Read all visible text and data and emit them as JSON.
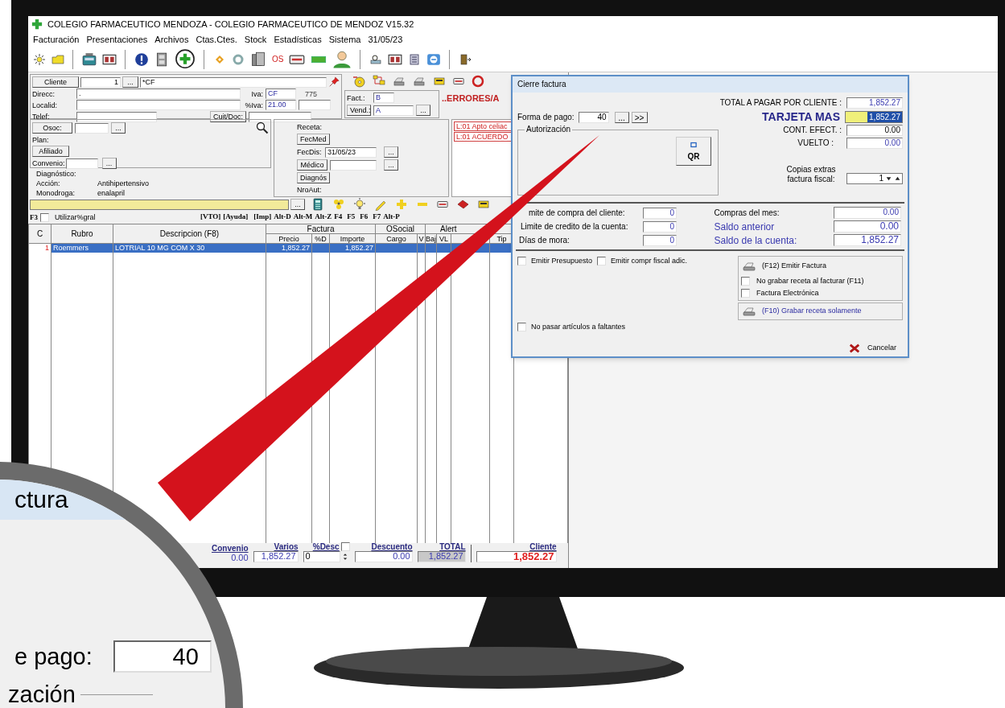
{
  "window": {
    "title": "COLEGIO FARMACEUTICO MENDOZA - COLEGIO FARMACEUTICO DE MENDOZ V15.32"
  },
  "menu": [
    {
      "label": "Facturación"
    },
    {
      "label": "Presentaciones"
    },
    {
      "label": "Archivos"
    },
    {
      "label": "Ctas.Ctes."
    },
    {
      "label": "Stock"
    },
    {
      "label": "Estadísticas"
    },
    {
      "label": "Sistema"
    },
    {
      "label": "31/05/23"
    }
  ],
  "toolbar": {
    "os_label": "OS"
  },
  "client": {
    "cliente_button": "Cliente",
    "code": "1",
    "more": "...",
    "name": "*CF",
    "direcc_label": "Direcc:",
    "direcc": ".",
    "iva_label": "Iva:",
    "iva": "CF",
    "iva_code": "775",
    "localid_label": "Localid:",
    "pct_iva_label": "%Iva:",
    "pct_iva": "21.00",
    "telef_label": "Telef:",
    "cuit_button": "Cuit/Doc:"
  },
  "invoice": {
    "fact_label": "Fact.:",
    "fact": "B",
    "vend_button": "Vend.:",
    "vend": "A",
    "more": "..."
  },
  "errors": {
    "title": "..ERRORES/A",
    "items": [
      "L:01 Apto celiac",
      "L:01 ACUERDO"
    ]
  },
  "obra_social": {
    "osoc_button": "Osoc:",
    "more": "...",
    "plan_label": "Plan:",
    "afiliado_button": "Afiliado",
    "convenio_label": "Convenio:",
    "convenio_more": "..."
  },
  "diagnosis": [
    {
      "label": "Diagnóstico:"
    },
    {
      "label": "Acción:",
      "value": "Antihipertensivo"
    },
    {
      "label": "Monodroga:",
      "value": "enalapril"
    }
  ],
  "prescription": {
    "receta_label": "Receta:",
    "fecmed_button": "FecMed",
    "fecdis_label": "FecDis:",
    "fecdis": "31/05/23",
    "fecdis_more": "...",
    "medico_button": "Médico",
    "medico_more": "...",
    "diagnos_button": "Diagnós",
    "nroaut_label": "NroAut:"
  },
  "search_bar": {
    "more": "..."
  },
  "shortcuts": {
    "f3_label": "F3",
    "utilizar_checked": false,
    "utilizar_label": "Utilizar%gral",
    "keys": [
      "[VTO]",
      "[Ayuda]",
      "[Imp]",
      "Alt-D",
      "Alt-M",
      "Alt-Z",
      "F4",
      "F5",
      "F6",
      "F7",
      "Alt-P"
    ]
  },
  "table": {
    "top_headers": [
      "C",
      "Rubro",
      "Descripcion (F8)",
      "Factura",
      "OSocial",
      "Alert"
    ],
    "sub_headers": [
      "Precio",
      "%D",
      "Importe",
      "Cargo",
      "V",
      "Baj",
      "VL",
      "Tip"
    ],
    "rows": [
      {
        "selected": true,
        "cells": [
          "1",
          "Roemmers",
          "LOTRIAL 10 MG COM X 30",
          "1,852.27",
          "",
          "1,852.27"
        ]
      }
    ]
  },
  "footer": {
    "convenio_label": "Convenio",
    "convenio": "0.00",
    "varios_label": "Varios",
    "varios": "1,852.27",
    "pct_desc_label": "%Desc",
    "pct_desc": "0",
    "descuento_checked": false,
    "descuento_label": "Descuento",
    "descuento": "0.00",
    "total_label": "TOTAL",
    "total": "1,852.27",
    "cliente_label": "Cliente",
    "cliente": "1,852.27"
  },
  "dialog": {
    "title": "Cierre factura",
    "total_label": "TOTAL A PAGAR POR CLIENTE :",
    "total": "1,852.27",
    "forma_pago_label": "Forma de pago:",
    "forma_pago": "40",
    "more": "...",
    "next": ">>",
    "autorizacion_label": "Autorización",
    "qr_button": "QR",
    "payment_label": "TARJETA MAS",
    "payment": "1,852.27",
    "payment_selected": true,
    "cont_label": "CONT. EFECT. :",
    "cont": "0.00",
    "vuelto_label": "VUELTO :",
    "vuelto": "0.00",
    "copias_label": "Copias extras factura fiscal:",
    "copias": "1",
    "limits": [
      {
        "label": "mite de compra del cliente:",
        "value": "0"
      },
      {
        "label": "Limite de credito de la cuenta:",
        "value": "0"
      },
      {
        "label": "Días de mora:",
        "value": "0"
      }
    ],
    "account": [
      {
        "label": "Compras del mes:",
        "value": "0.00",
        "emphasis": false
      },
      {
        "label": "Saldo anterior",
        "value": "0.00",
        "emphasis": true
      },
      {
        "label": "Saldo de la cuenta:",
        "value": "1,852.27",
        "emphasis": true
      }
    ],
    "options": [
      {
        "label": "Emitir Presupuesto",
        "checked": false
      },
      {
        "label": "Emitir compr fiscal adic.",
        "checked": false
      }
    ],
    "emit_button": "(F12) Emitir Factura",
    "emit_options": [
      {
        "label": "No grabar receta al facturar (F11)",
        "checked": false
      },
      {
        "label": "Factura Electrónica",
        "checked": false
      }
    ],
    "record_button": "(F10) Grabar receta solamente",
    "faltantes": {
      "label": "No pasar artículos a faltantes",
      "checked": false
    },
    "cancel_button": "Cancelar"
  },
  "magnifier": {
    "title_fragment": "ctura",
    "label_fragment": "e pago:",
    "value": "40",
    "group_fragment": "zación"
  }
}
